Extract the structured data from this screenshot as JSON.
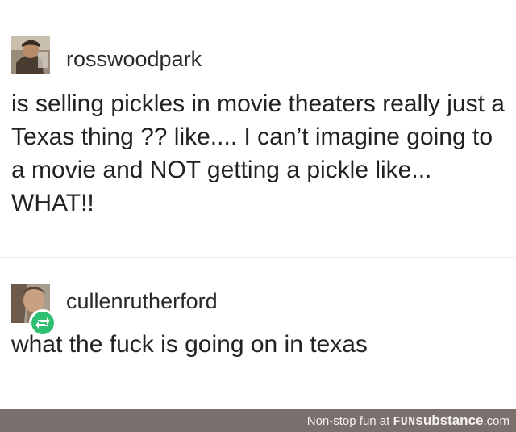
{
  "posts": [
    {
      "username": "rosswoodpark",
      "text": "is selling pickles in movie theaters really just a Texas thing ?? like.... I can’t imagine going to a movie and NOT getting a pickle like... WHAT!!"
    },
    {
      "username": "cullenrutherford",
      "text": "what the fuck is going on in texas"
    }
  ],
  "footer": {
    "prefix": "Non-stop fun at",
    "brand_part1": "FUN",
    "brand_part2": "substance",
    "brand_part3": ".com"
  },
  "colors": {
    "footer_bg": "#7a6f6d",
    "reblog_badge": "#2fbf71"
  }
}
